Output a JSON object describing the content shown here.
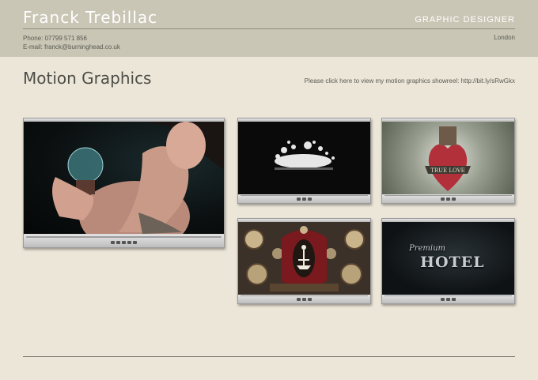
{
  "header": {
    "name": "Franck Trebillac",
    "role": "GRAPHIC DESIGNER",
    "phone": "Phone: 07799 571 856",
    "email": "E-mail: franck@burninghead.co.uk",
    "location": "London"
  },
  "main": {
    "title": "Motion Graphics",
    "showreel": "Please click here to view my motion graphics showreel: http://bit.ly/sRwGkx"
  },
  "thumbnails": {
    "hotel_word1": "Premium",
    "hotel_word2": "HOTEL",
    "banner_text": "TRUE LOVE"
  },
  "colors": {
    "background": "#ece6d8",
    "header": "#c9c6b5"
  }
}
